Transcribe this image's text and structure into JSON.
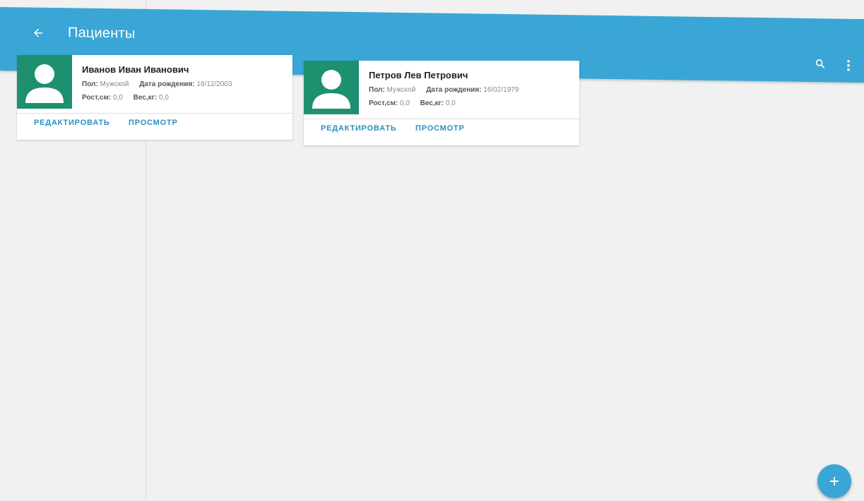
{
  "appbar": {
    "title": "Пациенты",
    "color": "#3aa6d5",
    "back_icon": "arrow-back-icon",
    "search_icon": "search-icon",
    "more_icon": "more-vert-icon"
  },
  "patients": [
    {
      "name": "Иванов Иван Иванович",
      "sex_label": "Пол:",
      "sex": "Мужской",
      "birth_label": "Дата рождения:",
      "birth": "18/12/2003",
      "height_label": "Рост,см:",
      "height": "0,0",
      "weight_label": "Вес,кг:",
      "weight": "0,0",
      "edit_label": "РЕДАКТИРОВАТЬ",
      "view_label": "ПРОСМОТР"
    },
    {
      "name": "Петров Лев Петрович",
      "sex_label": "Пол:",
      "sex": "Мужской",
      "birth_label": "Дата рождения:",
      "birth": "16/02/1979",
      "height_label": "Рост,см:",
      "height": "0,0",
      "weight_label": "Вес,кг:",
      "weight": "0,0",
      "edit_label": "РЕДАКТИРОВАТЬ",
      "view_label": "ПРОСМОТР"
    }
  ],
  "fab": {
    "icon": "add-icon"
  },
  "colors": {
    "avatar_bg": "#1e9070",
    "action_text": "#2a8fc2"
  }
}
